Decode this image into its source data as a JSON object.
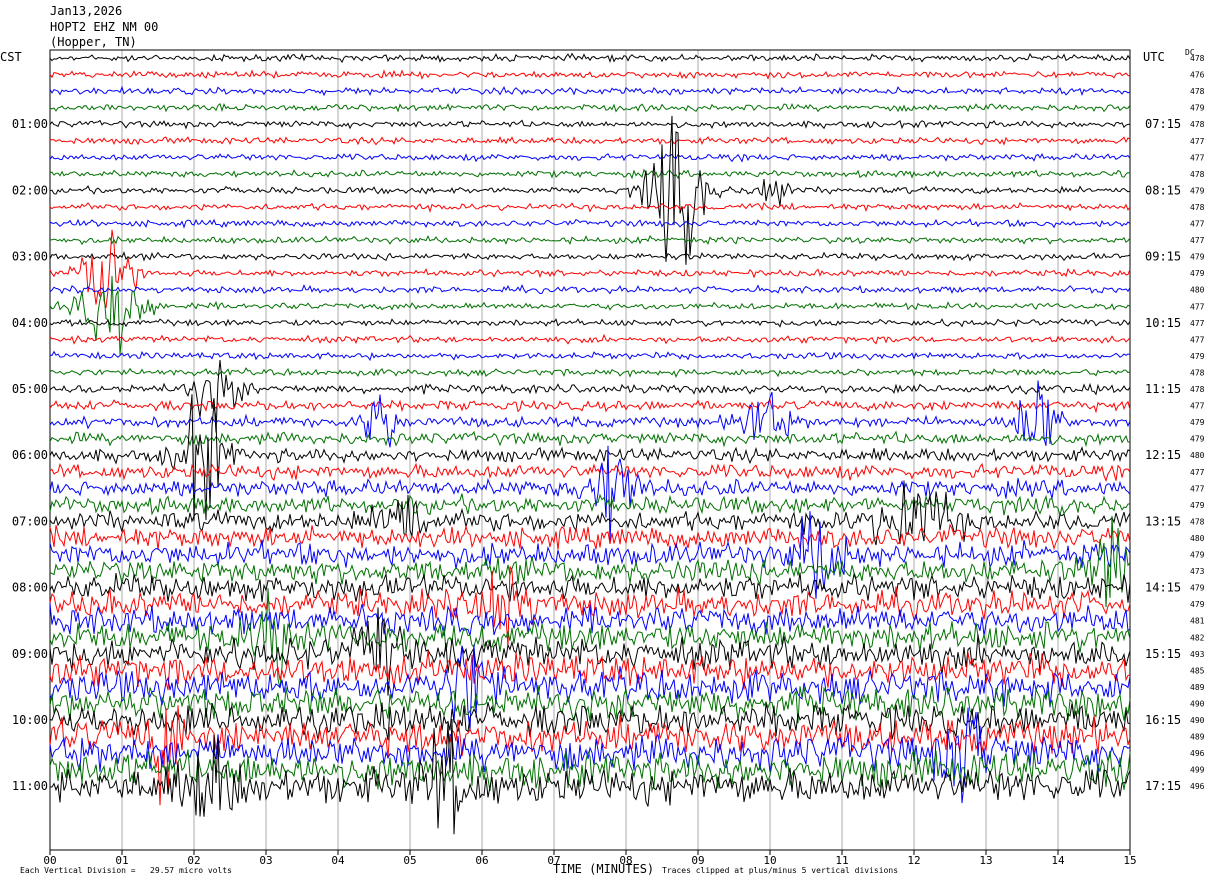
{
  "header": {
    "date": "Jan13,2026",
    "station": "HOPT2 EHZ NM 00",
    "location": "(Hopper, TN)"
  },
  "axes": {
    "left_tz": "CST",
    "right_tz": "UTC",
    "dc_label": "DC",
    "xlabel": "TIME (MINUTES)"
  },
  "footer": {
    "division_note": "Each Vertical Division =   29.57 micro volts",
    "clip_note": "Traces clipped at plus/minus 5 vertical divisions"
  },
  "colors": {
    "trace_cycle": [
      "#000000",
      "#ff0000",
      "#0000ff",
      "#007000"
    ],
    "grid": "#000000"
  },
  "chart_data": {
    "type": "line",
    "x_ticks": [
      "00",
      "01",
      "02",
      "03",
      "04",
      "05",
      "06",
      "07",
      "08",
      "09",
      "10",
      "11",
      "12",
      "13",
      "14",
      "15"
    ],
    "xlim": [
      0,
      15
    ],
    "left_hour_labels": [
      "01:00",
      "02:00",
      "03:00",
      "04:00",
      "05:00",
      "06:00",
      "07:00",
      "08:00",
      "09:00",
      "10:00",
      "11:00"
    ],
    "right_hour_labels": [
      "07:15",
      "08:15",
      "09:15",
      "10:15",
      "11:15",
      "12:15",
      "13:15",
      "14:15",
      "15:15",
      "16:15",
      "17:15"
    ],
    "dc_offsets": [
      478,
      476,
      478,
      479,
      478,
      477,
      477,
      478,
      479,
      478,
      477,
      477,
      479,
      479,
      480,
      477,
      477,
      477,
      479,
      478,
      478,
      477,
      479,
      479,
      480,
      477,
      477,
      479,
      478,
      480,
      479,
      473,
      479,
      479,
      481,
      482,
      493,
      485,
      489,
      490,
      490,
      489,
      496,
      499,
      496
    ],
    "trace_minutes": 15,
    "num_traces": 45,
    "traces_per_hour": 4,
    "activity_envelope": [
      1,
      1,
      1,
      1,
      1,
      1,
      1,
      1,
      1,
      1,
      1,
      1,
      1,
      1,
      1,
      1,
      1,
      1,
      1,
      1,
      1.3,
      1.5,
      1.6,
      1.8,
      2,
      2.2,
      2.5,
      2.6,
      3,
      3.2,
      3.5,
      3.6,
      3.8,
      4,
      4.2,
      4.4,
      4.6,
      4.7,
      4.8,
      4.9,
      5,
      5.1,
      5.2,
      5.3,
      5.4
    ],
    "events": [
      {
        "trace": 8,
        "minute": 8.7,
        "amp": 9,
        "width": 0.35
      },
      {
        "trace": 8,
        "minute": 10.0,
        "amp": 3,
        "width": 0.2
      },
      {
        "trace": 13,
        "minute": 0.8,
        "amp": 7,
        "width": 0.3
      },
      {
        "trace": 15,
        "minute": 0.9,
        "amp": 5,
        "width": 0.4
      },
      {
        "trace": 20,
        "minute": 2.3,
        "amp": 4,
        "width": 0.3
      },
      {
        "trace": 22,
        "minute": 4.6,
        "amp": 4,
        "width": 0.2
      },
      {
        "trace": 22,
        "minute": 9.9,
        "amp": 4,
        "width": 0.3
      },
      {
        "trace": 22,
        "minute": 13.7,
        "amp": 6,
        "width": 0.25
      },
      {
        "trace": 24,
        "minute": 2.1,
        "amp": 7,
        "width": 0.3
      },
      {
        "trace": 26,
        "minute": 7.8,
        "amp": 6,
        "width": 0.3
      },
      {
        "trace": 28,
        "minute": 4.9,
        "amp": 4,
        "width": 0.3
      },
      {
        "trace": 28,
        "minute": 12.0,
        "amp": 4,
        "width": 0.5
      },
      {
        "trace": 30,
        "minute": 10.7,
        "amp": 5,
        "width": 0.3
      },
      {
        "trace": 31,
        "minute": 14.8,
        "amp": 6,
        "width": 0.3
      },
      {
        "trace": 33,
        "minute": 6.3,
        "amp": 5,
        "width": 0.3
      },
      {
        "trace": 35,
        "minute": 3.2,
        "amp": 5,
        "width": 0.3
      },
      {
        "trace": 36,
        "minute": 4.6,
        "amp": 4,
        "width": 0.3
      },
      {
        "trace": 38,
        "minute": 5.8,
        "amp": 5,
        "width": 0.3
      },
      {
        "trace": 41,
        "minute": 1.6,
        "amp": 6,
        "width": 0.2
      },
      {
        "trace": 42,
        "minute": 12.7,
        "amp": 5,
        "width": 0.3
      },
      {
        "trace": 44,
        "minute": 5.5,
        "amp": 6,
        "width": 0.3
      },
      {
        "trace": 44,
        "minute": 2.2,
        "amp": 5,
        "width": 0.3
      }
    ]
  }
}
